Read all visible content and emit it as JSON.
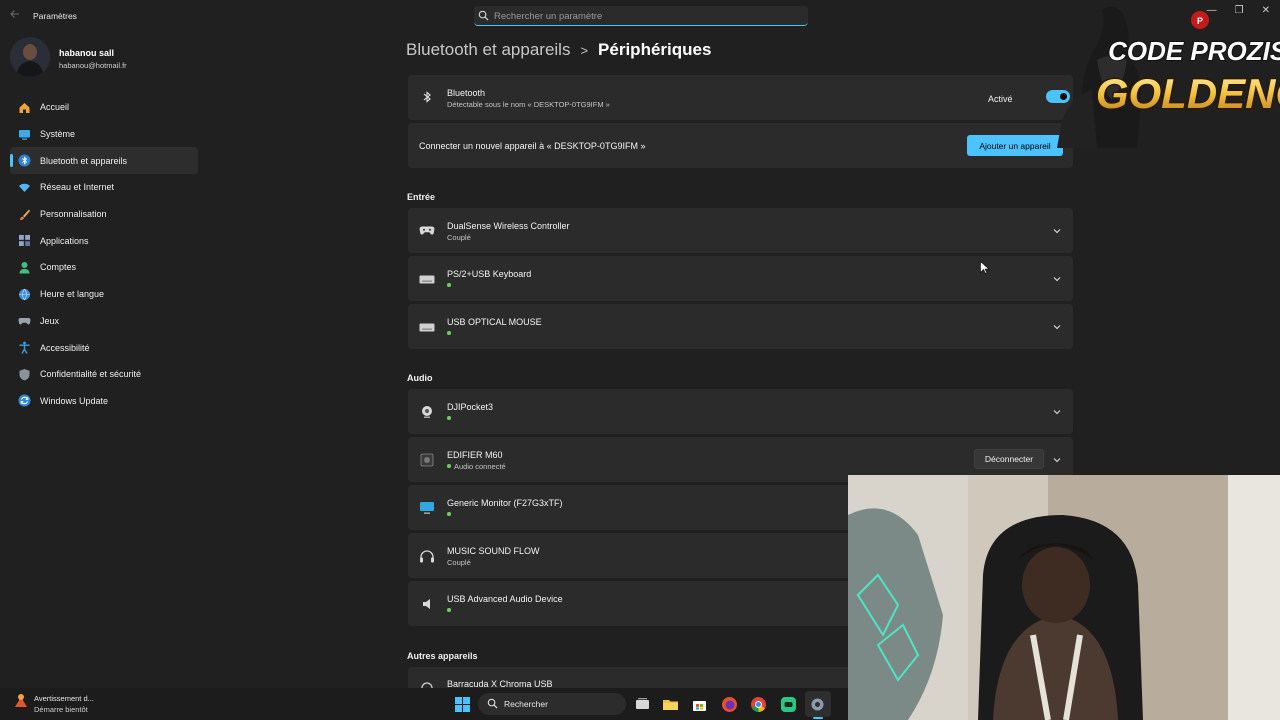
{
  "window": {
    "app_title": "Paramètres",
    "search_placeholder": "Rechercher un paramètre"
  },
  "user": {
    "name": "habanou sall",
    "email": "habanou@hotmail.fr"
  },
  "sidebar": {
    "items": [
      {
        "label": "Accueil",
        "icon": "home-icon"
      },
      {
        "label": "Système",
        "icon": "monitor-icon"
      },
      {
        "label": "Bluetooth et appareils",
        "icon": "bluetooth-icon",
        "active": true
      },
      {
        "label": "Réseau et Internet",
        "icon": "wifi-icon"
      },
      {
        "label": "Personnalisation",
        "icon": "brush-icon"
      },
      {
        "label": "Applications",
        "icon": "apps-icon"
      },
      {
        "label": "Comptes",
        "icon": "person-icon"
      },
      {
        "label": "Heure et langue",
        "icon": "globe-clock-icon"
      },
      {
        "label": "Jeux",
        "icon": "gamepad-icon"
      },
      {
        "label": "Accessibilité",
        "icon": "accessibility-icon"
      },
      {
        "label": "Confidentialité et sécurité",
        "icon": "shield-icon"
      },
      {
        "label": "Windows Update",
        "icon": "update-icon"
      }
    ]
  },
  "breadcrumb": {
    "parent": "Bluetooth et appareils",
    "separator": ">",
    "current": "Périphériques"
  },
  "bluetooth": {
    "title": "Bluetooth",
    "subtitle": "Détectable sous le nom « DESKTOP-0TG9IFM »",
    "toggle_label": "Activé",
    "toggle_on": true
  },
  "connect": {
    "text": "Connecter un nouvel appareil à « DESKTOP-0TG9IFM »",
    "button": "Ajouter un appareil"
  },
  "sections": {
    "input": "Entrée",
    "audio": "Audio",
    "other": "Autres appareils"
  },
  "input_devices": [
    {
      "name": "DualSense Wireless Controller",
      "status": "Couplé"
    },
    {
      "name": "PS/2+USB Keyboard",
      "status": ""
    },
    {
      "name": "USB OPTICAL MOUSE",
      "status": ""
    }
  ],
  "audio_devices": [
    {
      "name": "DJIPocket3",
      "status": ""
    },
    {
      "name": "EDIFIER M60",
      "status": "Audio connecté",
      "action": "Déconnecter"
    },
    {
      "name": "Generic Monitor (F27G3xTF)",
      "status": ""
    },
    {
      "name": "MUSIC SOUND FLOW",
      "status": "Couplé"
    },
    {
      "name": "USB Advanced Audio Device",
      "status": ""
    }
  ],
  "other_devices": [
    {
      "name": "Barracuda X Chroma USB"
    }
  ],
  "overlay": {
    "logo_line1": "CODE PROZIS:",
    "logo_line2": "GOLDENG"
  },
  "taskbar": {
    "notification_title": "Avertissement d...",
    "notification_sub": "Démarre bientôt",
    "search_label": "Rechercher"
  },
  "colors": {
    "accent": "#4cc2ff",
    "background": "#202020",
    "card": "#2b2b2b",
    "status_dot": "#6ccb5f"
  }
}
